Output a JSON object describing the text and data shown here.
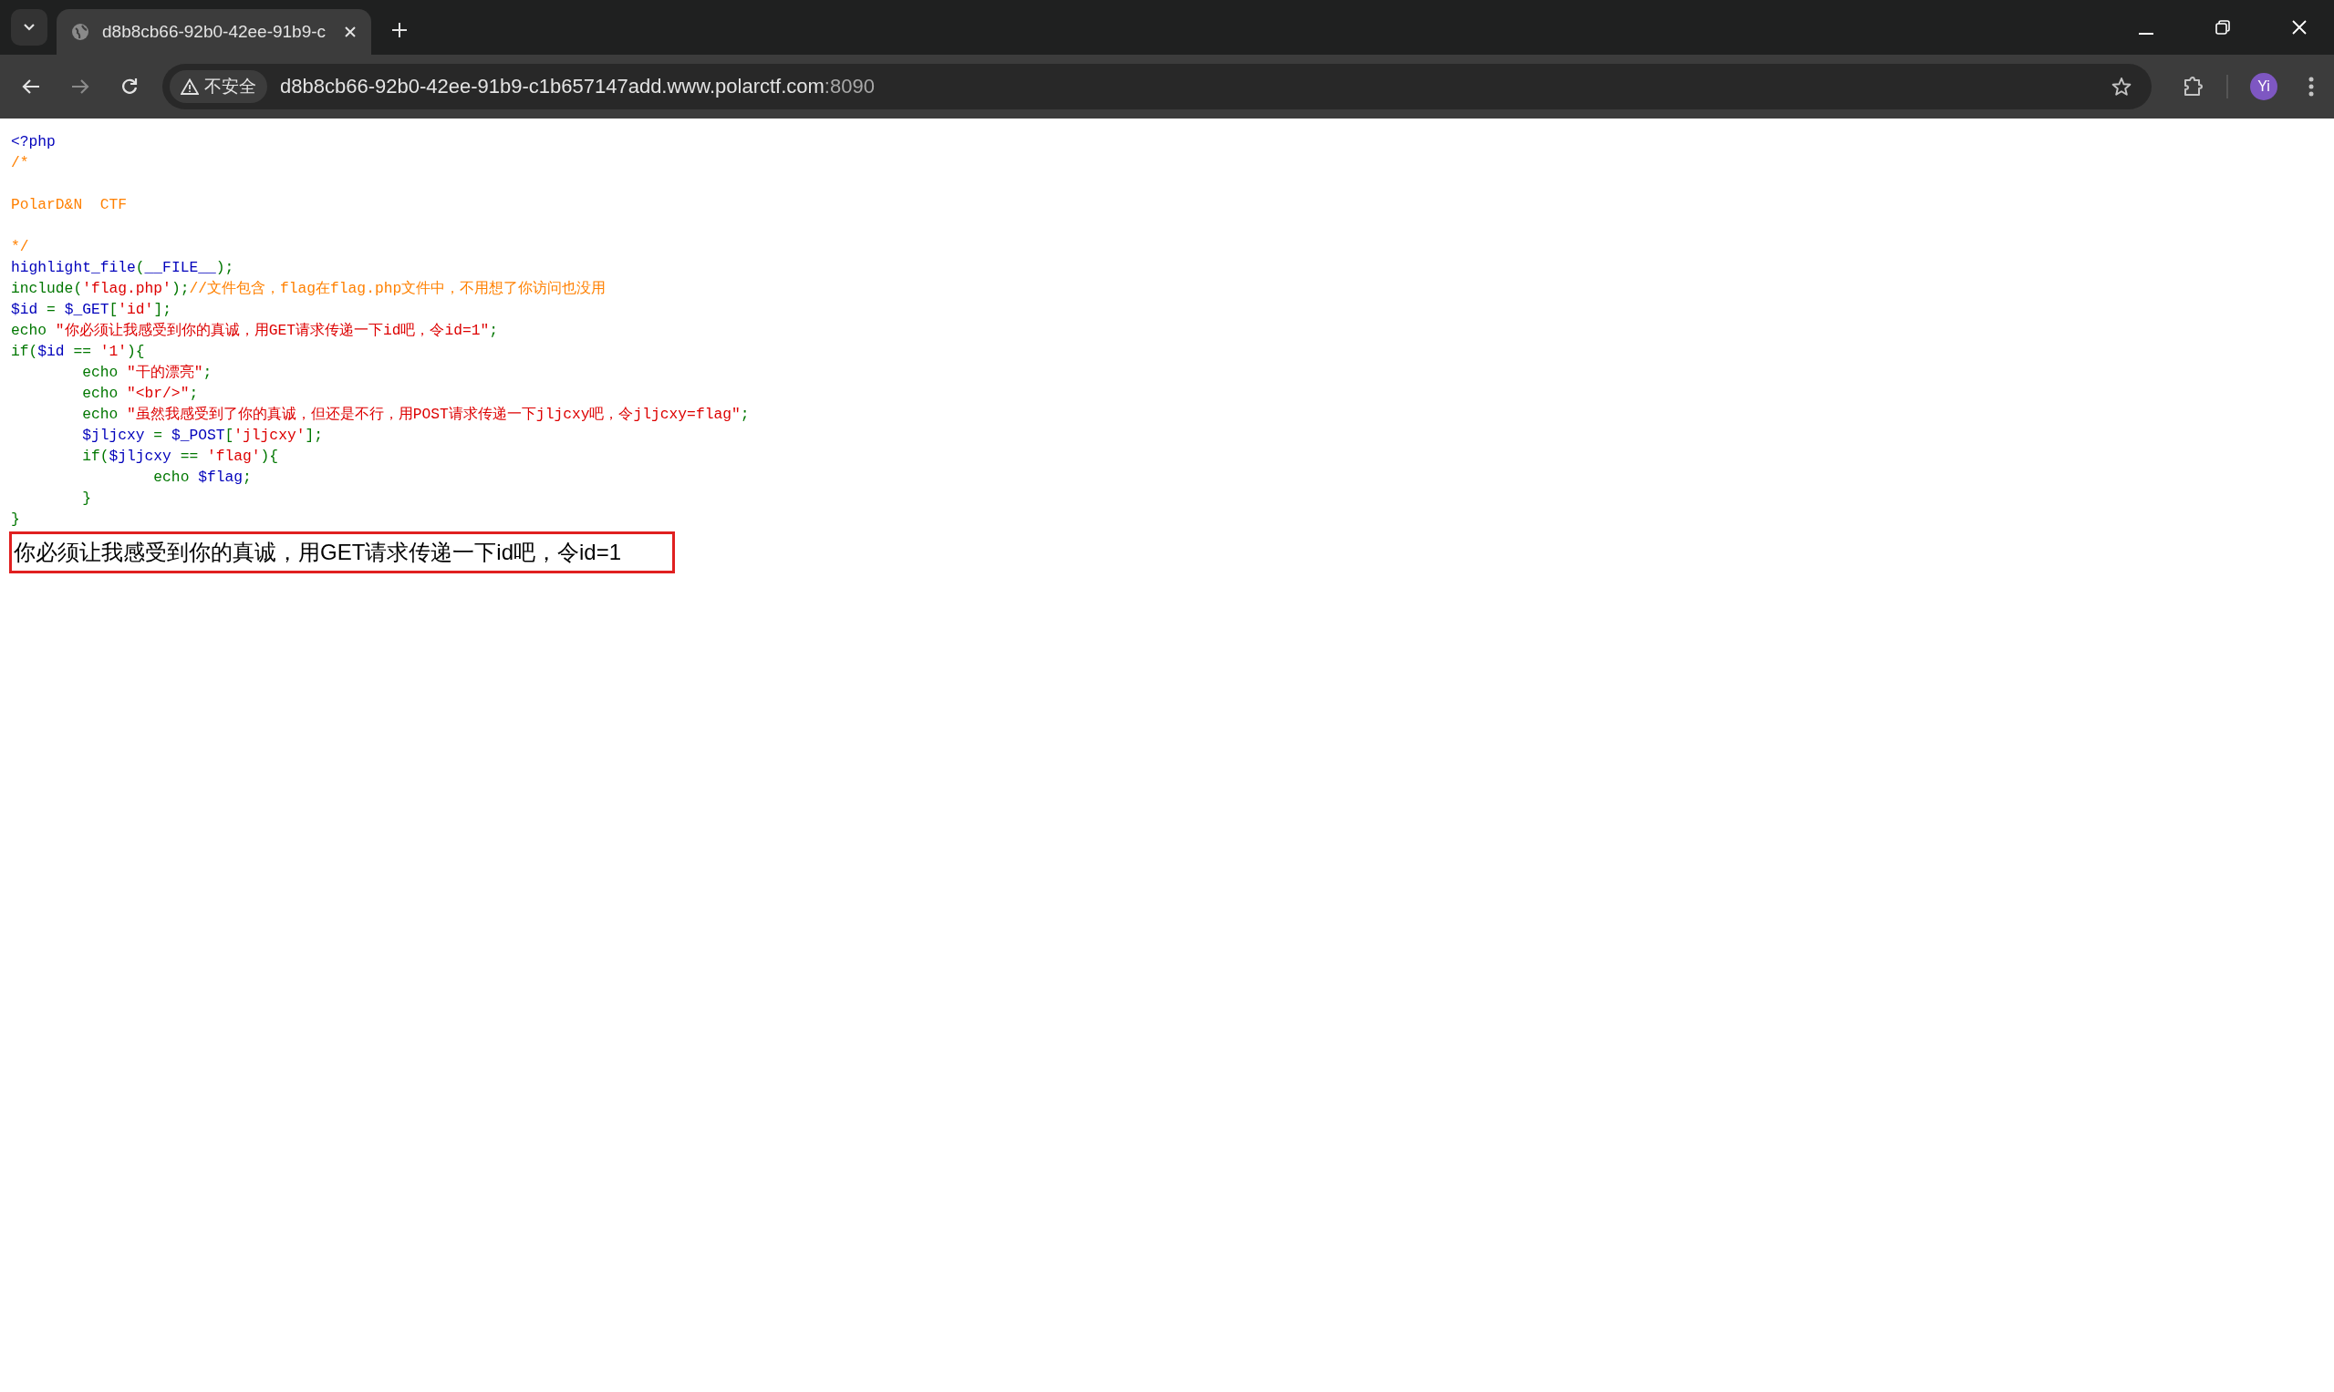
{
  "browser": {
    "tab": {
      "title": "d8b8cb66-92b0-42ee-91b9-c",
      "selected": true
    },
    "address_bar": {
      "security_label": "不安全",
      "url_host": "d8b8cb66-92b0-42ee-91b9-c1b657147add.www.polarctf.com",
      "url_port": ":8090"
    },
    "profile_initials": "Yi"
  },
  "source_code": [
    {
      "kind": "code",
      "tokens": [
        {
          "kind": "default",
          "text": "<?php"
        }
      ]
    },
    {
      "kind": "code",
      "tokens": [
        {
          "kind": "comment",
          "text": "/*"
        }
      ]
    },
    {
      "kind": "blank"
    },
    {
      "kind": "code",
      "tokens": [
        {
          "kind": "comment",
          "text": "PolarD&N  CTF"
        }
      ]
    },
    {
      "kind": "blank"
    },
    {
      "kind": "code",
      "tokens": [
        {
          "kind": "comment",
          "text": "*/"
        }
      ]
    },
    {
      "kind": "code",
      "tokens": [
        {
          "kind": "default",
          "text": "highlight_file"
        },
        {
          "kind": "keyword",
          "text": "("
        },
        {
          "kind": "default",
          "text": "__FILE__"
        },
        {
          "kind": "keyword",
          "text": ");"
        }
      ]
    },
    {
      "kind": "code",
      "tokens": [
        {
          "kind": "keyword",
          "text": "include("
        },
        {
          "kind": "string",
          "text": "'flag.php'"
        },
        {
          "kind": "keyword",
          "text": ");"
        },
        {
          "kind": "comment",
          "text": "//文件包含，flag在flag.php文件中，不用想了你访问也没用"
        }
      ]
    },
    {
      "kind": "code",
      "tokens": [
        {
          "kind": "default",
          "text": "$id "
        },
        {
          "kind": "keyword",
          "text": "= "
        },
        {
          "kind": "default",
          "text": "$_GET"
        },
        {
          "kind": "keyword",
          "text": "["
        },
        {
          "kind": "string",
          "text": "'id'"
        },
        {
          "kind": "keyword",
          "text": "];"
        }
      ]
    },
    {
      "kind": "code",
      "tokens": [
        {
          "kind": "keyword",
          "text": "echo "
        },
        {
          "kind": "string",
          "text": "\"你必须让我感受到你的真诚，用GET请求传递一下id吧，令id=1\""
        },
        {
          "kind": "keyword",
          "text": ";"
        }
      ]
    },
    {
      "kind": "code",
      "tokens": [
        {
          "kind": "keyword",
          "text": "if("
        },
        {
          "kind": "default",
          "text": "$id "
        },
        {
          "kind": "keyword",
          "text": "== "
        },
        {
          "kind": "string",
          "text": "'1'"
        },
        {
          "kind": "keyword",
          "text": "){"
        }
      ]
    },
    {
      "kind": "code",
      "tokens": [
        {
          "kind": "keyword",
          "text": "        echo "
        },
        {
          "kind": "string",
          "text": "\"干的漂亮\""
        },
        {
          "kind": "keyword",
          "text": ";"
        }
      ]
    },
    {
      "kind": "code",
      "tokens": [
        {
          "kind": "keyword",
          "text": "        echo "
        },
        {
          "kind": "string",
          "text": "\"<br/>\""
        },
        {
          "kind": "keyword",
          "text": ";"
        }
      ]
    },
    {
      "kind": "code",
      "tokens": [
        {
          "kind": "keyword",
          "text": "        echo "
        },
        {
          "kind": "string",
          "text": "\"虽然我感受到了你的真诚，但还是不行，用POST请求传递一下jljcxy吧，令jljcxy=flag\""
        },
        {
          "kind": "keyword",
          "text": ";"
        }
      ]
    },
    {
      "kind": "code",
      "tokens": [
        {
          "kind": "default",
          "text": "        $jljcxy "
        },
        {
          "kind": "keyword",
          "text": "= "
        },
        {
          "kind": "default",
          "text": "$_POST"
        },
        {
          "kind": "keyword",
          "text": "["
        },
        {
          "kind": "string",
          "text": "'jljcxy'"
        },
        {
          "kind": "keyword",
          "text": "];"
        }
      ]
    },
    {
      "kind": "code",
      "tokens": [
        {
          "kind": "keyword",
          "text": "        if("
        },
        {
          "kind": "default",
          "text": "$jljcxy "
        },
        {
          "kind": "keyword",
          "text": "== "
        },
        {
          "kind": "string",
          "text": "'flag'"
        },
        {
          "kind": "keyword",
          "text": "){"
        }
      ]
    },
    {
      "kind": "code",
      "tokens": [
        {
          "kind": "keyword",
          "text": "                echo "
        },
        {
          "kind": "default",
          "text": "$flag"
        },
        {
          "kind": "keyword",
          "text": ";"
        }
      ]
    },
    {
      "kind": "code",
      "tokens": [
        {
          "kind": "keyword",
          "text": "        }"
        }
      ]
    },
    {
      "kind": "code",
      "tokens": [
        {
          "kind": "keyword",
          "text": "}"
        }
      ]
    }
  ],
  "output_message": "你必须让我感受到你的真诚，用GET请求传递一下id吧，令id=1"
}
